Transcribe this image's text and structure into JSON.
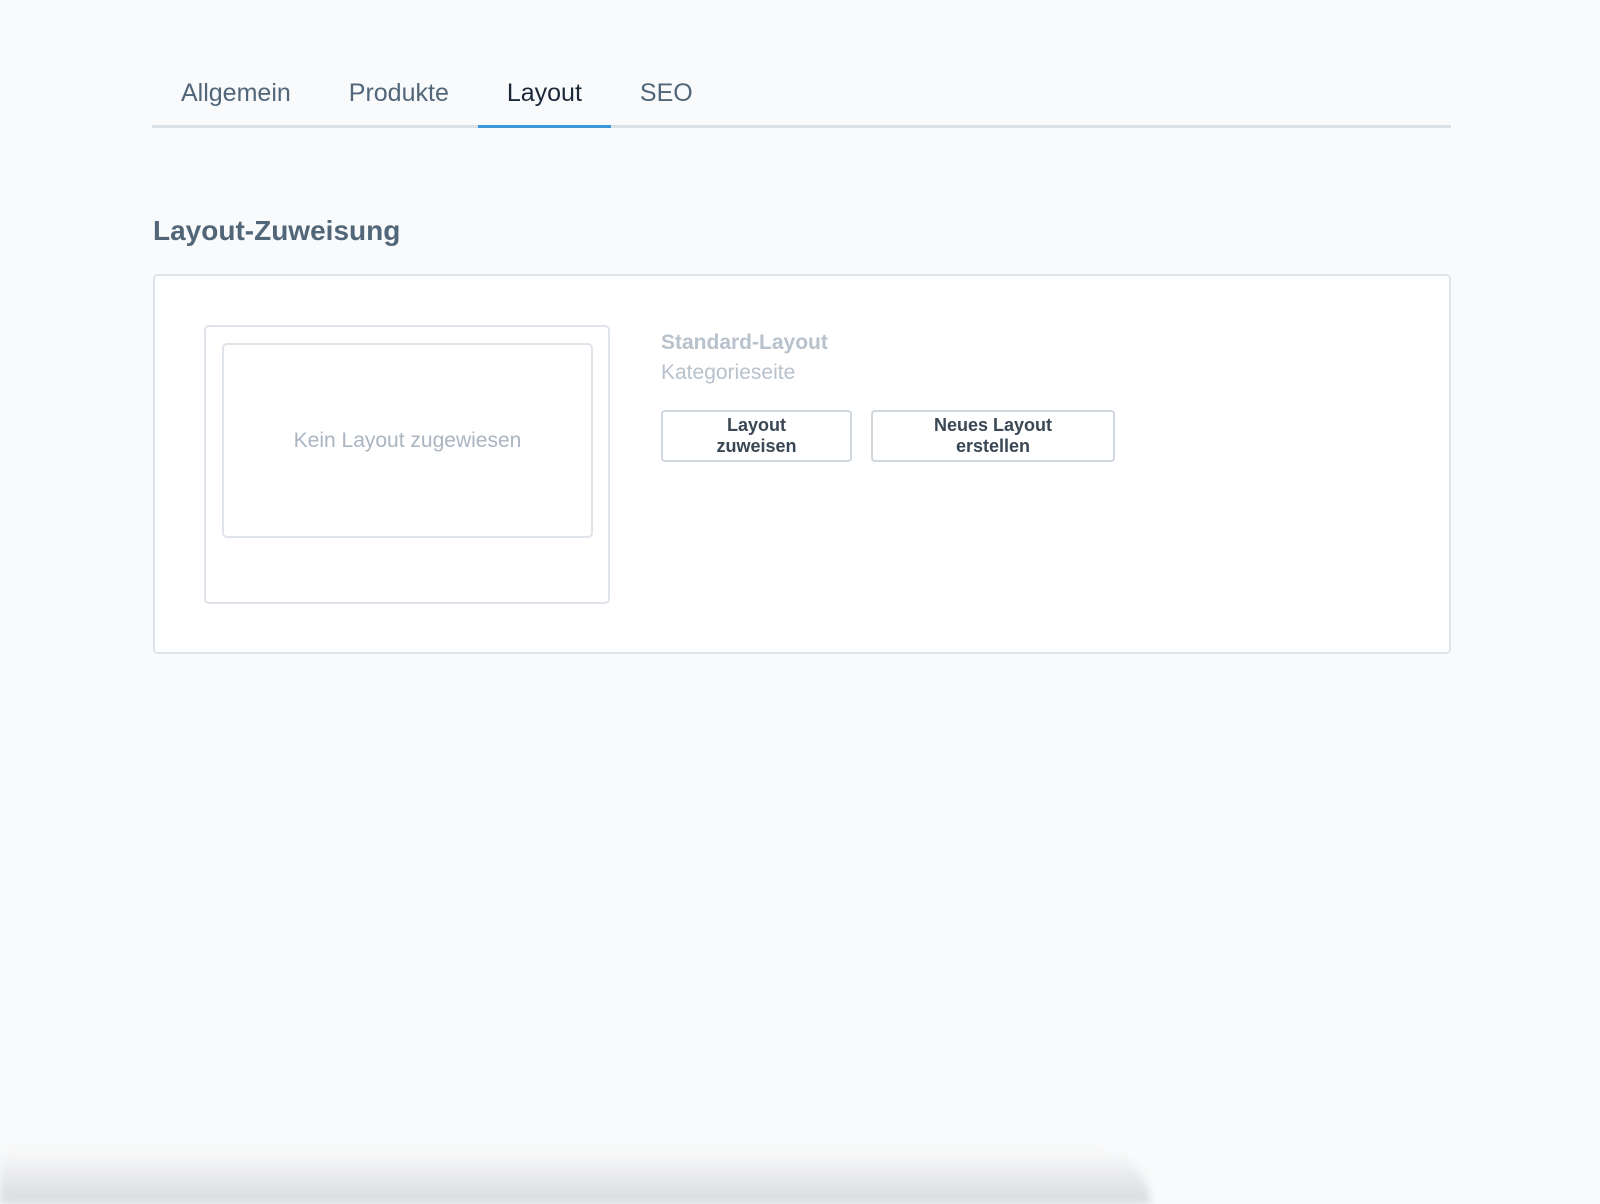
{
  "tabs": [
    {
      "label": "Allgemein",
      "active": false
    },
    {
      "label": "Produkte",
      "active": false
    },
    {
      "label": "Layout",
      "active": true
    },
    {
      "label": "SEO",
      "active": false
    }
  ],
  "section": {
    "title": "Layout-Zuweisung"
  },
  "layout": {
    "preview_placeholder": "Kein Layout zugewiesen",
    "name": "Standard-Layout",
    "type": "Kategorieseite",
    "assign_label": "Layout zuweisen",
    "create_label": "Neues Layout erstellen"
  },
  "colors": {
    "accent": "#3d96d8",
    "background": "#f9fafb"
  }
}
